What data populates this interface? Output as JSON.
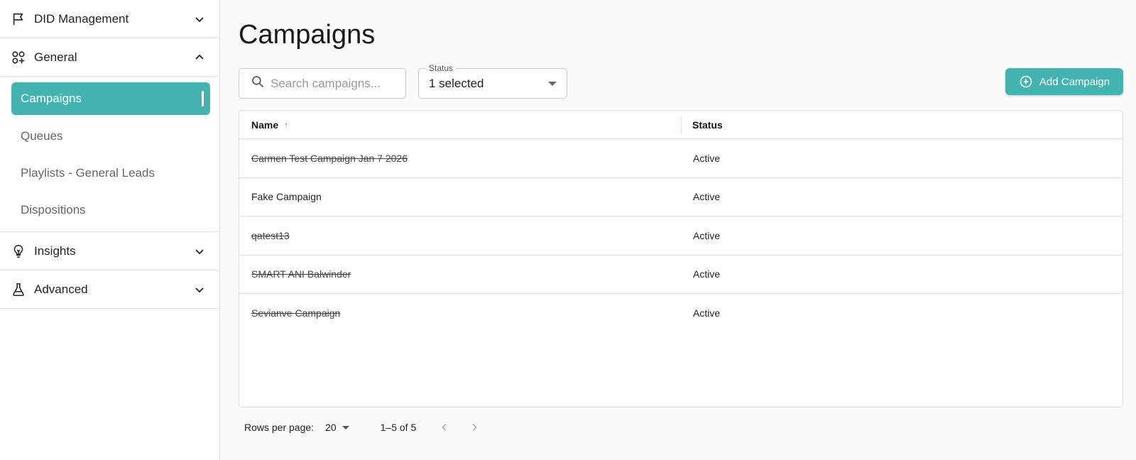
{
  "sidebar": {
    "sections": [
      {
        "label": "DID Management",
        "icon": "flag-icon",
        "expanded": false
      },
      {
        "label": "General",
        "icon": "shapes-icon",
        "expanded": true
      },
      {
        "label": "Insights",
        "icon": "lightbulb-icon",
        "expanded": false
      },
      {
        "label": "Advanced",
        "icon": "flask-icon",
        "expanded": false
      }
    ],
    "general_items": [
      {
        "label": "Campaigns",
        "active": true
      },
      {
        "label": "Queues"
      },
      {
        "label": "Playlists - General Leads"
      },
      {
        "label": "Dispositions"
      }
    ]
  },
  "page": {
    "title": "Campaigns",
    "search_placeholder": "Search campaigns...",
    "status_filter": {
      "legend": "Status",
      "value": "1 selected"
    },
    "add_button": "Add Campaign"
  },
  "table": {
    "columns": {
      "name": "Name",
      "sort_indicator": "↑",
      "status": "Status"
    },
    "rows": [
      {
        "name": "Carmen Test Campaign Jan 7 2026",
        "status": "Active",
        "struck": true
      },
      {
        "name": "Fake Campaign",
        "status": "Active",
        "struck": false
      },
      {
        "name": "qatest13",
        "status": "Active",
        "struck": true
      },
      {
        "name": "SMART ANI Balwinder",
        "status": "Active",
        "struck": true
      },
      {
        "name": "Sevianve Campaign",
        "status": "Active",
        "struck": true
      }
    ]
  },
  "pagination": {
    "rows_per_page_label": "Rows per page:",
    "rows_per_page": "20",
    "range": "1–5 of 5"
  },
  "colors": {
    "accent": "#43b3b0"
  }
}
